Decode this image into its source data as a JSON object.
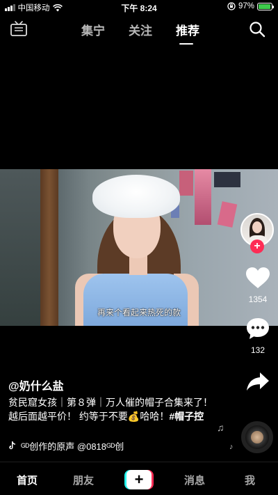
{
  "status_bar": {
    "carrier": "中国移动",
    "time": "下午 8:24",
    "battery_percent": "97%",
    "battery_level": 0.97
  },
  "top_nav": {
    "tabs": [
      {
        "label": "集宁",
        "active": false
      },
      {
        "label": "关注",
        "active": false
      },
      {
        "label": "推荐",
        "active": true
      }
    ]
  },
  "video": {
    "subtitle": "再来个看起来热死的款"
  },
  "actions": {
    "like_count": "1354",
    "comment_count": "132"
  },
  "caption": {
    "author": "@奶什么盐",
    "description": "贫民窟女孩｜第８弹｜万人催的帽子合集来了！越后面越平价！ 约等于不要💰哈哈！",
    "hashtag": "#帽子控"
  },
  "music": {
    "text": "ᴳᴰ创作的原声    @0818ᴳᴰ创"
  },
  "bottom_nav": {
    "items": [
      {
        "label": "首页",
        "active": true
      },
      {
        "label": "朋友",
        "active": false
      },
      {
        "label": "+",
        "active": false
      },
      {
        "label": "消息",
        "active": false
      },
      {
        "label": "我",
        "active": false
      }
    ]
  },
  "colors": {
    "accent_red": "#fe2c55",
    "accent_cyan": "#25f4ee",
    "battery_green": "#3ecb4c"
  }
}
